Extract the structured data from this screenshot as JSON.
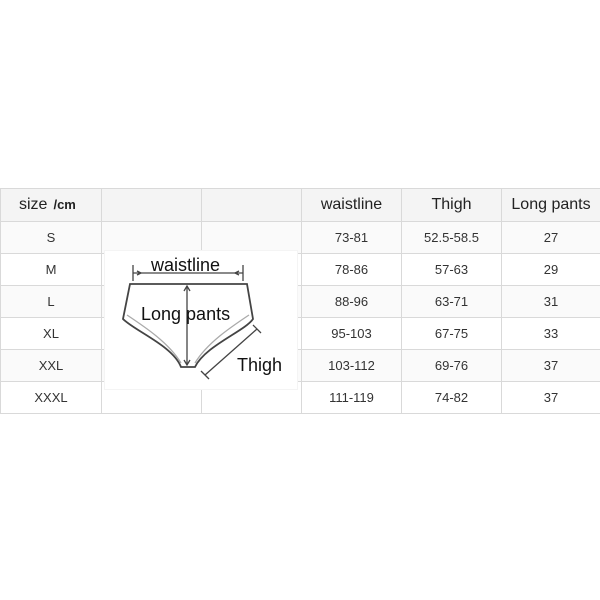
{
  "table": {
    "header": {
      "size_label": "size",
      "unit_label": "/cm",
      "columns": [
        "waistline",
        "Thigh",
        "Long pants"
      ]
    },
    "rows": [
      {
        "size": "S",
        "waistline": "73-81",
        "thigh": "52.5-58.5",
        "long_pants": "27"
      },
      {
        "size": "M",
        "waistline": "78-86",
        "thigh": "57-63",
        "long_pants": "29"
      },
      {
        "size": "L",
        "waistline": "88-96",
        "thigh": "63-71",
        "long_pants": "31"
      },
      {
        "size": "XL",
        "waistline": "95-103",
        "thigh": "67-75",
        "long_pants": "33"
      },
      {
        "size": "XXL",
        "waistline": "103-112",
        "thigh": "69-76",
        "long_pants": "37"
      },
      {
        "size": "XXXL",
        "waistline": "111-119",
        "thigh": "74-82",
        "long_pants": "37"
      }
    ]
  },
  "diagram": {
    "waist_label": "waistline",
    "length_label": "Long pants",
    "thigh_label": "Thigh"
  }
}
